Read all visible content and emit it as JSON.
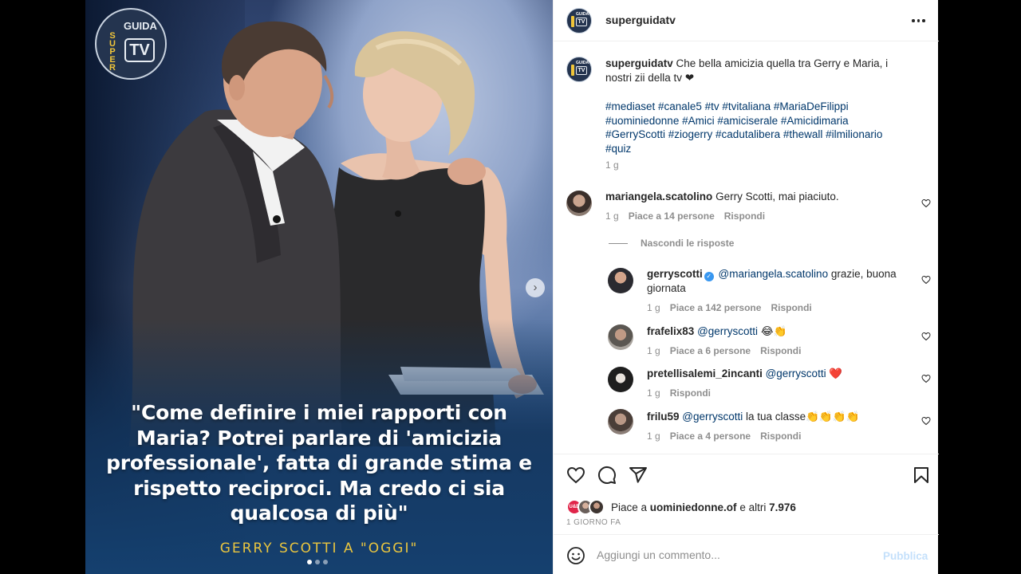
{
  "post": {
    "username": "superguidatv",
    "caption_user": "superguidatv",
    "caption": "Che bella amicizia quella tra Gerry e Maria, i nostri zii della tv",
    "caption_heart": "❤",
    "hashtags": "#mediaset #canale5 #tv #tvitaliana #MariaDeFilippi #uominiedonne #Amici #amiciserale #Amicidimaria #GerryScotti #ziogerry #cadutalibera #thewall #ilmilionario #quiz",
    "caption_time": "1 g"
  },
  "media": {
    "logo_super": "SUPER",
    "logo_guida": "GUIDA",
    "logo_tv": "TV",
    "quote": "\"Come definire i miei rapporti con Maria? Potrei parlare di 'amicizia professionale', fatta di grande stima e rispetto reciproci. Ma credo ci sia qualcosa di più\"",
    "quote_author": "GERRY SCOTTI A \"OGGI\"",
    "slide_count": 3,
    "active_slide": 1
  },
  "comments": [
    {
      "user": "mariangela.scatolino",
      "text": "Gerry Scotti, mai piaciuto.",
      "time": "1 g",
      "likes": "Piace a 14 persone",
      "reply": "Rispondi"
    }
  ],
  "hide_replies": "Nascondi le risposte",
  "replies": [
    {
      "user": "gerryscotti",
      "verified": true,
      "mention": "@mariangela.scatolino",
      "text": "grazie, buona giornata",
      "time": "1 g",
      "likes": "Piace a 142 persone",
      "reply": "Rispondi"
    },
    {
      "user": "frafelix83",
      "mention": "@gerryscotti",
      "text": "😂👏",
      "time": "1 g",
      "likes": "Piace a 6 persone",
      "reply": "Rispondi"
    },
    {
      "user": "pretellisalemi_2incanti",
      "mention": "@gerryscotti",
      "text": "❤️",
      "time": "1 g",
      "likes": "",
      "reply": "Rispondi"
    },
    {
      "user": "frilu59",
      "mention": "@gerryscotti",
      "text": "la tua classe👏👏👏👏",
      "time": "1 g",
      "likes": "Piace a 4 persone",
      "reply": "Rispondi"
    }
  ],
  "likes": {
    "prefix": "Piace a",
    "user": "uominiedonne.of",
    "suffix": "e altri",
    "count": "7.976",
    "avatar_label": "U&D"
  },
  "post_time": "1 GIORNO FA",
  "add_comment": {
    "placeholder": "Aggiungi un commento...",
    "publish": "Pubblica"
  },
  "colors": {
    "link": "#00376b",
    "muted": "#8e8e8e",
    "publish_disabled": "#c4e0fb",
    "logo_yellow": "#f0c53a",
    "quote_author": "#e9c53f"
  },
  "icons": [
    "heart-icon",
    "comment-icon",
    "share-icon",
    "bookmark-icon",
    "more-icon",
    "emoji-icon",
    "verified-icon",
    "chevron-right-icon"
  ]
}
